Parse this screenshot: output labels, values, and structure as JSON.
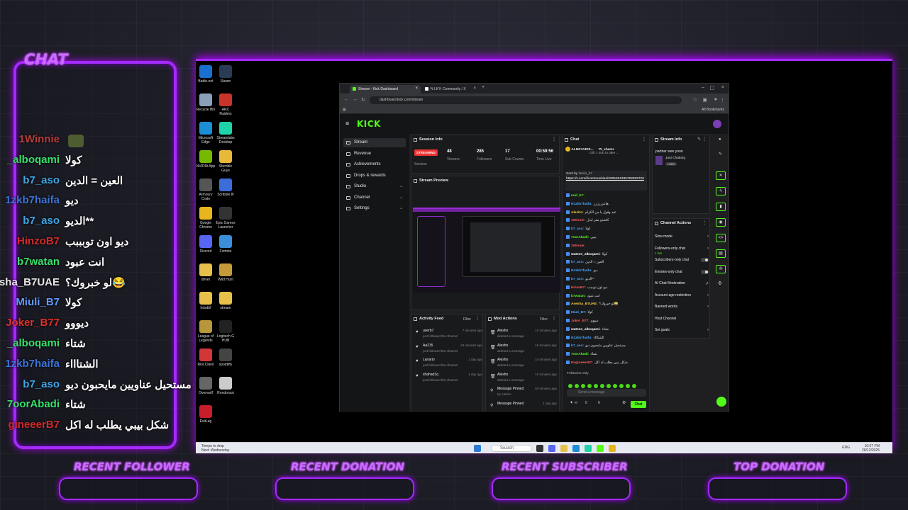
{
  "overlay": {
    "chat_title": "CHAT",
    "chat_lines": [
      {
        "user": "1Winnie",
        "message": "",
        "color": "#b53c3c"
      },
      {
        "user": "_alboqami",
        "message": "كولا",
        "color": "#36e06a"
      },
      {
        "user": "b7_aso",
        "message": "العين = الدين",
        "color": "#3ea7e6"
      },
      {
        "user": "1zkb7haifa",
        "message": "ديو",
        "color": "#3b74d8"
      },
      {
        "user": "b7_aso",
        "message": "الديو**",
        "color": "#3ea7e6"
      },
      {
        "user": "HinzoB7",
        "message": "ديو اون توبببب",
        "color": "#d22a2a"
      },
      {
        "user": "b7watan",
        "message": "انت عبود",
        "color": "#36e06a"
      },
      {
        "user": "sha_B7UAE",
        "message": "لو خبروك؟😂",
        "color": "#e8e8e8"
      },
      {
        "user": "Miuli_B7",
        "message": "كولا",
        "color": "#5f9bff"
      },
      {
        "user": "Joker_B77",
        "message": "ديووو",
        "color": "#e0302a"
      },
      {
        "user": "_alboqami",
        "message": "شتاء",
        "color": "#36e06a"
      },
      {
        "user": "1zkb7haifa",
        "message": "الشتاااء",
        "color": "#3b74d8"
      },
      {
        "user": "b7_aso",
        "message": "مستحيل عناويين مايحبون ديو",
        "color": "#3ea7e6"
      },
      {
        "user": "7oorAbadi",
        "message": "شتاء",
        "color": "#36e06a"
      },
      {
        "user": "gineeerB7",
        "message": "شكل بيبي يطلب له اكل",
        "color": "#d22a2a"
      }
    ],
    "widgets": [
      "RECENT FOLLOWER",
      "RECENT DONATION",
      "RECENT SUBSCRIBER",
      "TOP DONATION"
    ]
  },
  "desktop": {
    "icons": [
      {
        "label": "Battle.net",
        "color": "#1a6fd1"
      },
      {
        "label": "Steam",
        "color": "#2a3b55"
      },
      {
        "label": "Recycle Bin",
        "color": "#8aa0b8"
      },
      {
        "label": "ARC Raiders",
        "color": "#c8342a"
      },
      {
        "label": "Microsoft Edge",
        "color": "#1b8ed6"
      },
      {
        "label": "Streamlabs Desktop",
        "color": "#1dd3a7"
      },
      {
        "label": "NVIDIA App",
        "color": "#76b900"
      },
      {
        "label": "Stumble Guys",
        "color": "#e8b83a"
      },
      {
        "label": "Armoury Crate",
        "color": "#555"
      },
      {
        "label": "Scribble It!",
        "color": "#3b6dd8"
      },
      {
        "label": "Google Chrome",
        "color": "#e9b51e"
      },
      {
        "label": "Epic Games Launcher",
        "color": "#333"
      },
      {
        "label": "Discord",
        "color": "#5865f2"
      },
      {
        "label": "Fortnite",
        "color": "#3a8fd8"
      },
      {
        "label": "driver",
        "color": "#e6c04a"
      },
      {
        "label": "Wild Hunt",
        "color": "#c49a3a"
      },
      {
        "label": "hdsdbf",
        "color": "#e6c04a"
      },
      {
        "label": "stream",
        "color": "#e6c04a"
      },
      {
        "label": "League of Legends",
        "color": "#b8963a"
      },
      {
        "label": "Logitech G HUB",
        "color": "#222"
      },
      {
        "label": "Riot Client",
        "color": "#d13639"
      },
      {
        "label": "spotdiffy",
        "color": "#444"
      },
      {
        "label": "Overwolf",
        "color": "#666"
      },
      {
        "label": "Rondonssi",
        "color": "#ccc"
      },
      {
        "label": "ExitLag",
        "color": "#c81e2b"
      }
    ],
    "taskbar": {
      "weather": "Tempo to drop",
      "weather_sub": "Next: Wednesday",
      "search_placeholder": "Search",
      "tray": "ENG",
      "time": "10:07 PM",
      "date": "26/12/2025"
    }
  },
  "browser": {
    "tabs": [
      {
        "label": "Stream - Kick Dashboard",
        "active": true
      },
      {
        "label": "N LK7r Community / X",
        "active": false
      }
    ],
    "url": "dashboard.kick.com/stream",
    "all_bookmarks": "All Bookmarks"
  },
  "kick": {
    "logo": "KICK",
    "nav": [
      {
        "label": "Stream",
        "active": true,
        "chevron": false
      },
      {
        "label": "Revenue",
        "active": false,
        "chevron": false
      },
      {
        "label": "Achievements",
        "active": false,
        "chevron": false
      },
      {
        "label": "Drops & rewards",
        "active": false,
        "chevron": false
      },
      {
        "label": "Studio",
        "active": false,
        "chevron": true
      },
      {
        "label": "Channel",
        "active": false,
        "chevron": true
      },
      {
        "label": "Settings",
        "active": false,
        "chevron": true
      }
    ],
    "session_info": {
      "title": "Session Info",
      "badge": "STREAMING",
      "stats": [
        {
          "value": "",
          "label": "Session"
        },
        {
          "value": "48",
          "label": "Viewers"
        },
        {
          "value": "285",
          "label": "Followers"
        },
        {
          "value": "17",
          "label": "Sub Counts"
        },
        {
          "value": "00:59:56",
          "label": "Time Live"
        }
      ]
    },
    "stream_preview": {
      "title": "Stream Preview"
    },
    "activity_feed": {
      "title": "Activity Feed",
      "filter": "Filter",
      "items": [
        {
          "user": "userb7",
          "sub": "just followed the channel",
          "time": "7 minutes ago"
        },
        {
          "user": "Aa215",
          "sub": "just followed the channel",
          "time": "44 minutes ago"
        },
        {
          "user": "Lanario",
          "sub": "just followed the channel",
          "time": "1 day ago"
        },
        {
          "user": "shahad1q",
          "sub": "just followed the channel",
          "time": "1 day ago"
        }
      ]
    },
    "mod_actions": {
      "title": "Mod Actions",
      "filter": "Filter",
      "items": [
        {
          "user": "Alesho",
          "sub": "deleted a message",
          "time": "10 minutes ago"
        },
        {
          "user": "Alesho",
          "sub": "deleted a message",
          "time": "10 minutes ago"
        },
        {
          "user": "Alesho",
          "sub": "deleted a message",
          "time": "10 minutes ago"
        },
        {
          "user": "Alesho",
          "sub": "deleted a message",
          "time": "10 minutes ago"
        },
        {
          "user": "Message Pinned",
          "sub": "by Alesho",
          "time": "50 minutes ago"
        },
        {
          "user": "Message Pinned",
          "sub": "",
          "time": "1 day ago"
        }
      ]
    },
    "chat": {
      "title": "Chat",
      "pinned_user": "ALNEYADIS...",
      "pinned_user2": "PI_shamr",
      "pinned_note": "Gift 1 sub to take ...",
      "sent_by": "Sent by",
      "sent_by_user": "lamia_b7",
      "pinned_link": "https://x.com/i/communities/2005284335792828720",
      "lines": [
        {
          "user": "raid_b7:",
          "msg": ""
        },
        {
          "user": "N1zkb7haifa:",
          "msg": "هاعزززززز"
        },
        {
          "user": "Alesho:",
          "msg": "عيد وقول يا من الكرام"
        },
        {
          "user": "1Winnie:",
          "msg": "كاشدو مغر ابدل"
        },
        {
          "user": "b7_aso:",
          "msg": "كولا"
        },
        {
          "user": "7oorAbadi:",
          "msg": "بيبي"
        },
        {
          "user": "1Winnie:",
          "msg": ""
        },
        {
          "user": "wateen_alboqami:",
          "msg": "كولا"
        },
        {
          "user": "b7_aso:",
          "msg": "العين = الدين"
        },
        {
          "user": "N1zkb7haifa:",
          "msg": "ديو"
        },
        {
          "user": "b7_aso:",
          "msg": "الديو**"
        },
        {
          "user": "HinzoB7:",
          "msg": "ديو اون توبببب"
        },
        {
          "user": "b7watan:",
          "msg": "انت عبود"
        },
        {
          "user": "Asesha_B7UAE:",
          "msg": "لو خبروك؟😂"
        },
        {
          "user": "Miuli_B7:",
          "msg": "كولا"
        },
        {
          "user": "Joker_B77:",
          "msg": "ديووو"
        },
        {
          "user": "wateen_alboqami:",
          "msg": "شتاء"
        },
        {
          "user": "N1zkb7haifa:",
          "msg": "الشتاااء"
        },
        {
          "user": "b7_aso:",
          "msg": "مستحيل عناويين مايحبون ديو"
        },
        {
          "user": "7oorAbadi:",
          "msg": "شتاء"
        },
        {
          "user": "EngineeerB7:",
          "msg": "شكل بيبي يطلب له اكل"
        }
      ],
      "followers_only": "Followers only",
      "send_placeholder": "Send a message",
      "count_a": "0",
      "count_b": "0",
      "chat_button": "Chat"
    },
    "stream_info": {
      "title": "Stream Info",
      "stream_title": "partner wee yooo",
      "category": "Just Chatting",
      "language": "Arabic"
    },
    "channel_actions": {
      "title": "Channel Actions",
      "items": [
        {
          "label": "Slow mode",
          "sub": "",
          "control": "chevron"
        },
        {
          "label": "Followers-only chat",
          "sub": "1 min",
          "control": "chevron"
        },
        {
          "label": "Subscribers-only chat",
          "sub": "",
          "control": "toggle"
        },
        {
          "label": "Emotes-only chat",
          "sub": "",
          "control": "toggle"
        },
        {
          "label": "AI Chat Moderation",
          "sub": "",
          "control": "external"
        },
        {
          "label": "Account age restriction",
          "sub": "",
          "control": "chevron"
        },
        {
          "label": "Banned words",
          "sub": "",
          "control": "chevron"
        },
        {
          "label": "Host Channel",
          "sub": "",
          "control": "none"
        },
        {
          "label": "Set goals",
          "sub": "",
          "control": "chevron"
        }
      ]
    }
  },
  "colors": {
    "kick_green": "#53fc18",
    "neon_purple": "#a42bff"
  }
}
